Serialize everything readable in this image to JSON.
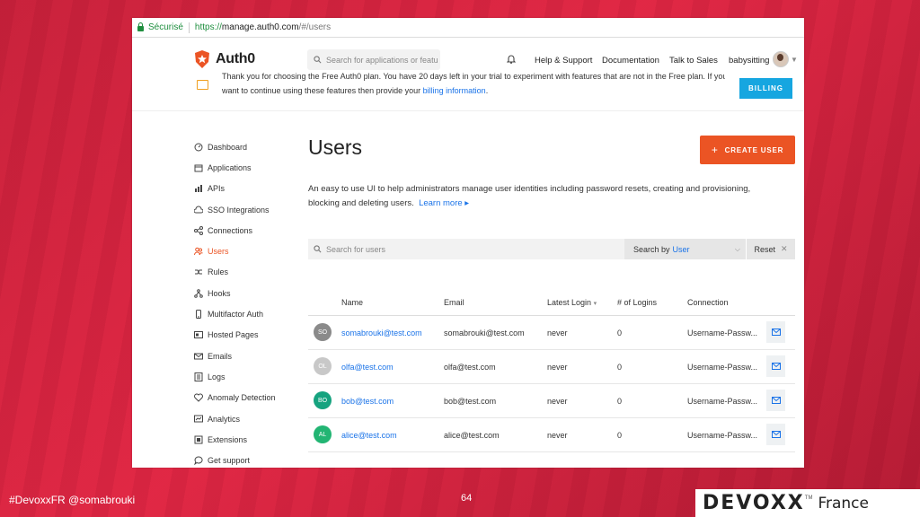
{
  "browser": {
    "secure_label": "Sécurisé",
    "url_scheme": "https://",
    "url_host": "manage.auth0.com",
    "url_path": "/#/users"
  },
  "header": {
    "logo_text": "Auth0",
    "search_placeholder": "Search for applications or featu",
    "nav": [
      "Help & Support",
      "Documentation",
      "Talk to Sales"
    ],
    "tenant": "babysitting"
  },
  "banner": {
    "line1": "Thank you for choosing the Free Auth0 plan. You have 20 days left in your trial to experiment with features that are not in the Free plan. If you",
    "line2_prefix": "want to continue using these features then provide your ",
    "line2_link": "billing information",
    "line2_suffix": ".",
    "billing_button": "BILLING"
  },
  "sidebar": {
    "items": [
      {
        "label": "Dashboard",
        "icon": "dashboard-icon"
      },
      {
        "label": "Applications",
        "icon": "applications-icon"
      },
      {
        "label": "APIs",
        "icon": "apis-icon"
      },
      {
        "label": "SSO Integrations",
        "icon": "cloud-icon"
      },
      {
        "label": "Connections",
        "icon": "connections-icon"
      },
      {
        "label": "Users",
        "icon": "users-icon",
        "active": true
      },
      {
        "label": "Rules",
        "icon": "rules-icon"
      },
      {
        "label": "Hooks",
        "icon": "hooks-icon"
      },
      {
        "label": "Multifactor Auth",
        "icon": "phone-icon"
      },
      {
        "label": "Hosted Pages",
        "icon": "hosted-pages-icon"
      },
      {
        "label": "Emails",
        "icon": "email-icon"
      },
      {
        "label": "Logs",
        "icon": "logs-icon"
      },
      {
        "label": "Anomaly Detection",
        "icon": "heart-icon"
      },
      {
        "label": "Analytics",
        "icon": "analytics-icon"
      },
      {
        "label": "Extensions",
        "icon": "extensions-icon"
      },
      {
        "label": "Get support",
        "icon": "chat-icon"
      }
    ]
  },
  "main": {
    "title": "Users",
    "create_button": "CREATE USER",
    "description": "An easy to use UI to help administrators manage user identities including password resets, creating and provisioning, blocking and deleting users.",
    "learn_more": "Learn more ▸",
    "search_placeholder": "Search for users",
    "search_by_label": "Search by",
    "search_by_value": "User",
    "reset_label": "Reset"
  },
  "table": {
    "headers": {
      "name": "Name",
      "email": "Email",
      "latest_login": "Latest Login",
      "logins": "# of Logins",
      "connection": "Connection"
    },
    "rows": [
      {
        "initials": "SO",
        "color": "#8a8a8a",
        "name": "somabrouki@test.com",
        "email": "somabrouki@test.com",
        "latest_login": "never",
        "logins": "0",
        "connection": "Username-Passw..."
      },
      {
        "initials": "OL",
        "color": "#c8c8c8",
        "name": "olfa@test.com",
        "email": "olfa@test.com",
        "latest_login": "never",
        "logins": "0",
        "connection": "Username-Passw..."
      },
      {
        "initials": "BO",
        "color": "#16a37f",
        "name": "bob@test.com",
        "email": "bob@test.com",
        "latest_login": "never",
        "logins": "0",
        "connection": "Username-Passw..."
      },
      {
        "initials": "AL",
        "color": "#22b573",
        "name": "alice@test.com",
        "email": "alice@test.com",
        "latest_login": "never",
        "logins": "0",
        "connection": "Username-Passw..."
      }
    ]
  },
  "footer": {
    "hashtag": "#DevoxxFR @somabrouki",
    "page_number": "64",
    "brand_word": "DEVOXX",
    "brand_tm": "TM",
    "brand_country": "France"
  },
  "colors": {
    "accent": "#eb5424",
    "link": "#1a73e8",
    "billing": "#16a6e0",
    "background": "#e02744"
  }
}
